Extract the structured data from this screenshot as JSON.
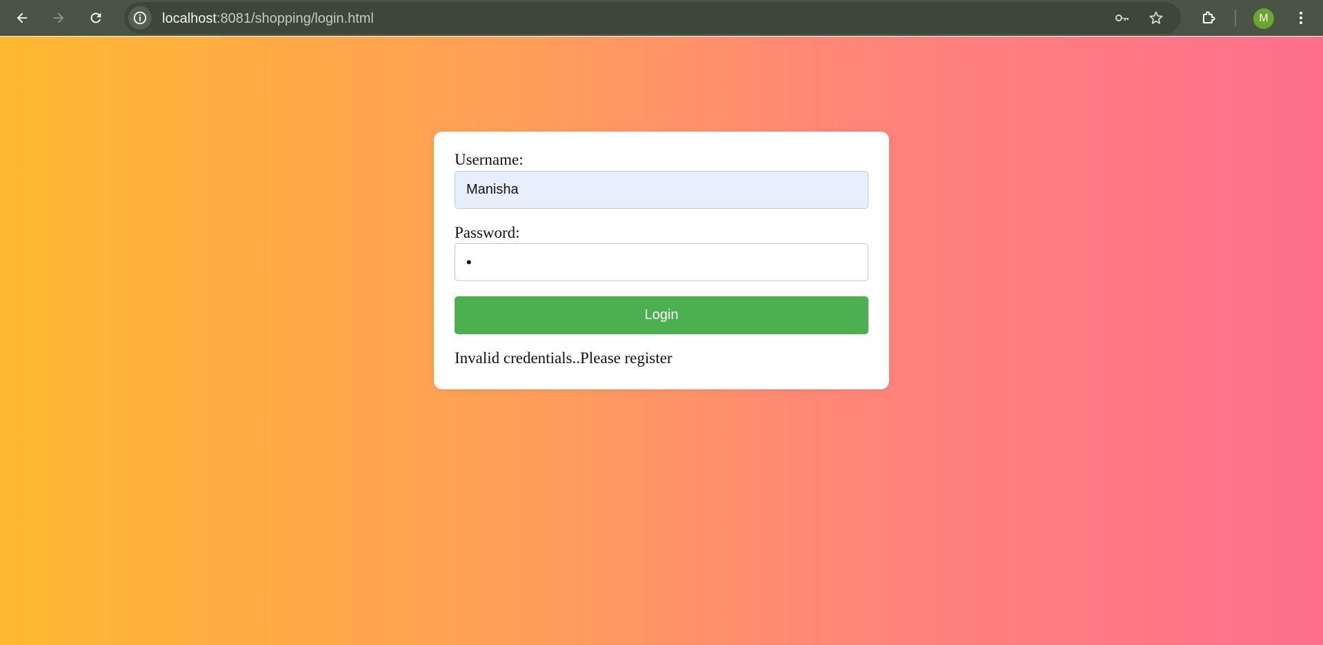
{
  "browser": {
    "url_host": "localhost",
    "url_rest": ":8081/shopping/login.html",
    "profile_initial": "M",
    "icons": {
      "back": "arrow-left-icon",
      "forward": "arrow-right-icon",
      "reload": "reload-icon",
      "site_info": "info-icon",
      "password_key": "key-icon",
      "bookmark": "star-icon",
      "extensions": "puzzle-icon",
      "menu": "kebab-menu-icon"
    }
  },
  "page": {
    "background_colors": [
      "#ffb830",
      "#ff6f8c"
    ],
    "login_form": {
      "username_label": "Username:",
      "username_value": "Manisha",
      "password_label": "Password:",
      "password_value": "•",
      "login_button_label": "Login",
      "button_color": "#4caf50",
      "error_message": "Invalid credentials..Please register"
    }
  }
}
